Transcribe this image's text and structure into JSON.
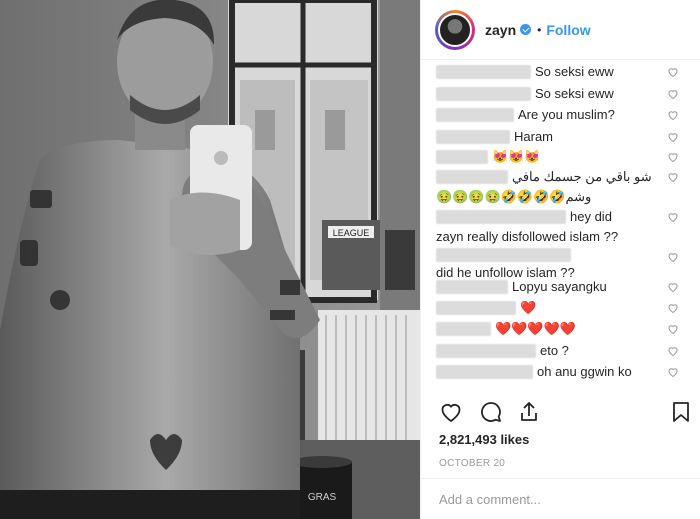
{
  "post": {
    "username": "zayn",
    "verified": true,
    "separator": "•",
    "follow_label": "Follow"
  },
  "comments": [
    {
      "text": "So seksi eww"
    },
    {
      "text": "So seksi eww"
    },
    {
      "text": "Are you muslim?"
    },
    {
      "text": "Haram"
    },
    {
      "text": "😻😻😻"
    },
    {
      "text": "شو باقي من جسمك مافي",
      "text2": "🤢🤢🤢🤢🤣🤣🤣🤣وشم"
    },
    {
      "text": "hey did",
      "text2": "zayn really disfollowed islam ??"
    },
    {
      "text": "did he unfollow islam ??"
    },
    {
      "text": "Lopyu sayangku"
    },
    {
      "text": "❤️"
    },
    {
      "text": "❤️❤️❤️❤️❤️"
    },
    {
      "text": "eto ?"
    },
    {
      "text": "oh anu ggwin ko"
    }
  ],
  "likes": "2,821,493 likes",
  "date": "OCTOBER 20",
  "add_comment": {
    "placeholder": "Add a comment..."
  },
  "icons": {
    "like": "heart-outline-icon",
    "comment": "speech-bubble-icon",
    "share": "share-arrow-icon",
    "save": "bookmark-icon"
  },
  "photo": {
    "mug_text": "GRAS",
    "poster_text": "LEAGUE"
  }
}
